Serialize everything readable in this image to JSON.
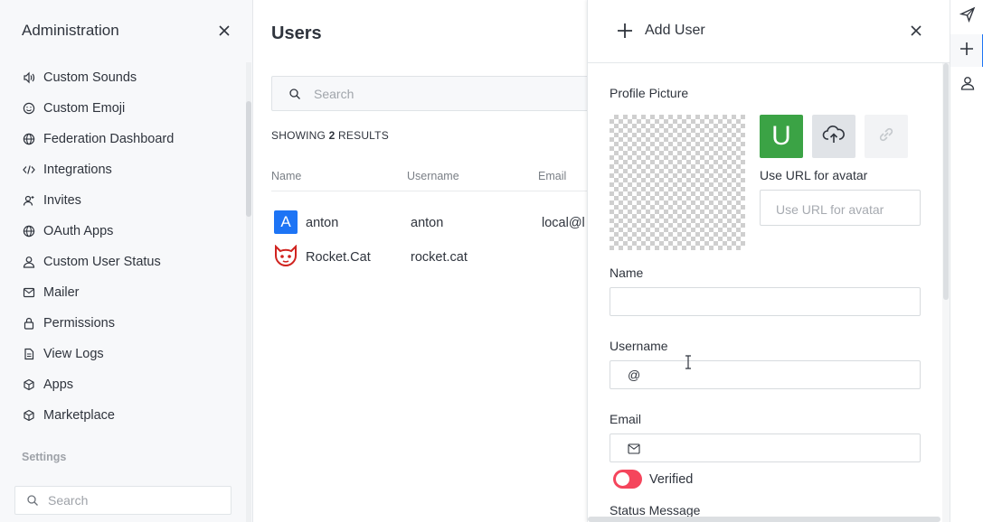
{
  "sidebar": {
    "title": "Administration",
    "items": [
      {
        "label": "Custom Sounds",
        "icon": "sound-icon"
      },
      {
        "label": "Custom Emoji",
        "icon": "emoji-icon"
      },
      {
        "label": "Federation Dashboard",
        "icon": "globe-icon"
      },
      {
        "label": "Integrations",
        "icon": "code-icon"
      },
      {
        "label": "Invites",
        "icon": "invite-icon"
      },
      {
        "label": "OAuth Apps",
        "icon": "globe-icon"
      },
      {
        "label": "Custom User Status",
        "icon": "user-icon"
      },
      {
        "label": "Mailer",
        "icon": "mail-icon"
      },
      {
        "label": "Permissions",
        "icon": "lock-icon"
      },
      {
        "label": "View Logs",
        "icon": "file-icon"
      },
      {
        "label": "Apps",
        "icon": "cube-icon"
      },
      {
        "label": "Marketplace",
        "icon": "cube-icon"
      }
    ],
    "settings_label": "Settings",
    "search_placeholder": "Search"
  },
  "main": {
    "title": "Users",
    "search_placeholder": "Search",
    "showing_prefix": "SHOWING",
    "showing_count": "2",
    "showing_suffix": "RESULTS",
    "columns": [
      "Name",
      "Username",
      "Email"
    ],
    "rows": [
      {
        "name": "anton",
        "username": "anton",
        "email": "local@l",
        "avatar_letter": "A"
      },
      {
        "name": "Rocket.Cat",
        "username": "rocket.cat",
        "email": ""
      }
    ]
  },
  "panel": {
    "title": "Add User",
    "profile_picture_label": "Profile Picture",
    "avatar_letter": "U",
    "use_url_label": "Use URL for avatar",
    "use_url_placeholder": "Use URL for avatar",
    "name_label": "Name",
    "name_value": "",
    "username_label": "Username",
    "username_prefix": "@",
    "email_label": "Email",
    "email_value": "",
    "verified_label": "Verified",
    "verified_on": false,
    "status_message_label": "Status Message"
  },
  "colors": {
    "accent": "#1d74f5",
    "avatar_u": "#3ba345",
    "toggle_off": "#f5455c",
    "cat_red": "#d0231f"
  }
}
